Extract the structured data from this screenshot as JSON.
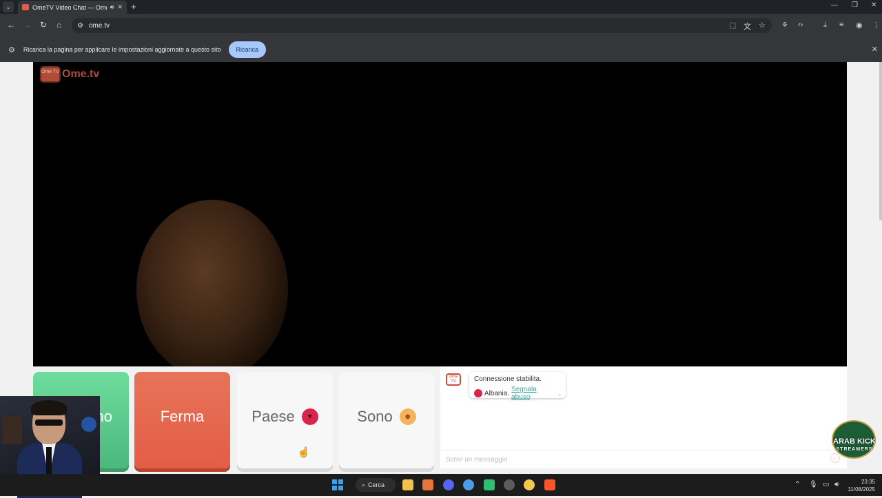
{
  "browser": {
    "tab_title": "OmeTV Video Chat — Ome",
    "url": "ome.tv",
    "new_tab_symbol": "+",
    "infobar_text": "Ricarica la pagina per applicare le impostazioni aggiornate a questo sito",
    "reload_button": "Ricarica"
  },
  "app": {
    "logo_text": "Ome.tv",
    "logo_badge": "Ome TV",
    "start_label": "no",
    "stop_label": "Ferma",
    "country_label": "Paese",
    "gender_label": "Sono",
    "chat": {
      "status": "Connessione stabilita.",
      "country": "Albania.",
      "report_link": "Segnala abuso",
      "report_suffix": ".",
      "input_placeholder": "Scrivi un messaggio"
    }
  },
  "overlay": {
    "badge_title": "ARAB KICK",
    "badge_sub": "STREAMERS"
  },
  "taskbar": {
    "search_label": "Cerca",
    "time": "23:35",
    "date": "11/08/2025",
    "apps": [
      "file-explorer-icon",
      "app-a-icon",
      "discord-icon",
      "chrome-icon",
      "app-green-icon",
      "obs-icon",
      "emoji-app-icon",
      "brave-icon"
    ],
    "colors": {
      "file_explorer": "#f2c14b",
      "app_a": "#e8743b",
      "discord": "#5865f2",
      "chrome": "#4a9ee8",
      "green": "#2fbf71",
      "obs": "#5c5c5c",
      "emoji": "#f3c84b",
      "brave": "#fb542b"
    }
  },
  "colors": {
    "start_button": "#4cb97c",
    "stop_button": "#e35d45",
    "accent_link": "#3ca39a",
    "reload_button_bg": "#a8c7fa"
  }
}
